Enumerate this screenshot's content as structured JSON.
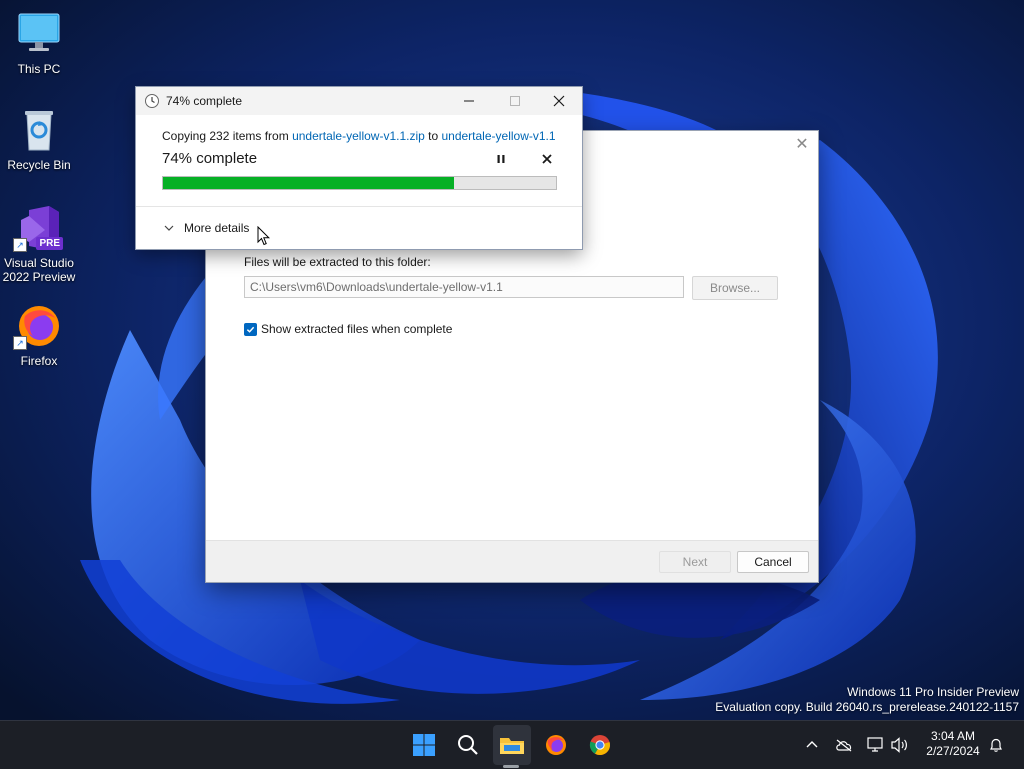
{
  "desktop": {
    "icons": [
      {
        "label": "This PC",
        "icon": "monitor-icon"
      },
      {
        "label": "Recycle Bin",
        "icon": "recycle-bin-icon"
      },
      {
        "label": "Visual Studio 2022 Preview",
        "icon": "visual-studio-icon",
        "badge": "PRE"
      },
      {
        "label": "Firefox",
        "icon": "firefox-icon"
      }
    ]
  },
  "extract_window": {
    "close_glyph": "✕",
    "destination_label": "Files will be extracted to this folder:",
    "destination_path": "C:\\Users\\vm6\\Downloads\\undertale-yellow-v1.1",
    "browse_label": "Browse...",
    "show_files_label": "Show extracted files when complete",
    "show_files_checked": true,
    "next_label": "Next",
    "cancel_label": "Cancel"
  },
  "progress_dialog": {
    "title": "74% complete",
    "copy_prefix": "Copying 232 items from ",
    "source": "undertale-yellow-v1.1.zip",
    "to_word": " to ",
    "destination": "undertale-yellow-v1.1",
    "percent_text": "74% complete",
    "progress_fraction": 0.74,
    "more_details_label": "More details"
  },
  "watermark": {
    "line1": "Windows 11 Pro Insider Preview",
    "line2": "Evaluation copy. Build 26040.rs_prerelease.240122-1157"
  },
  "taskbar": {
    "apps": [
      "start-icon",
      "search-icon",
      "file-explorer-icon",
      "firefox-icon",
      "chrome-icon"
    ],
    "tray": [
      "chevron-up-icon",
      "cloud-offline-icon",
      "network-icon",
      "volume-icon",
      "notification-bell-icon"
    ],
    "time": "3:04 AM",
    "date": "2/27/2024"
  },
  "colors": {
    "accent": "#0067c0",
    "progress": "#06b025",
    "link": "#0066b4"
  }
}
